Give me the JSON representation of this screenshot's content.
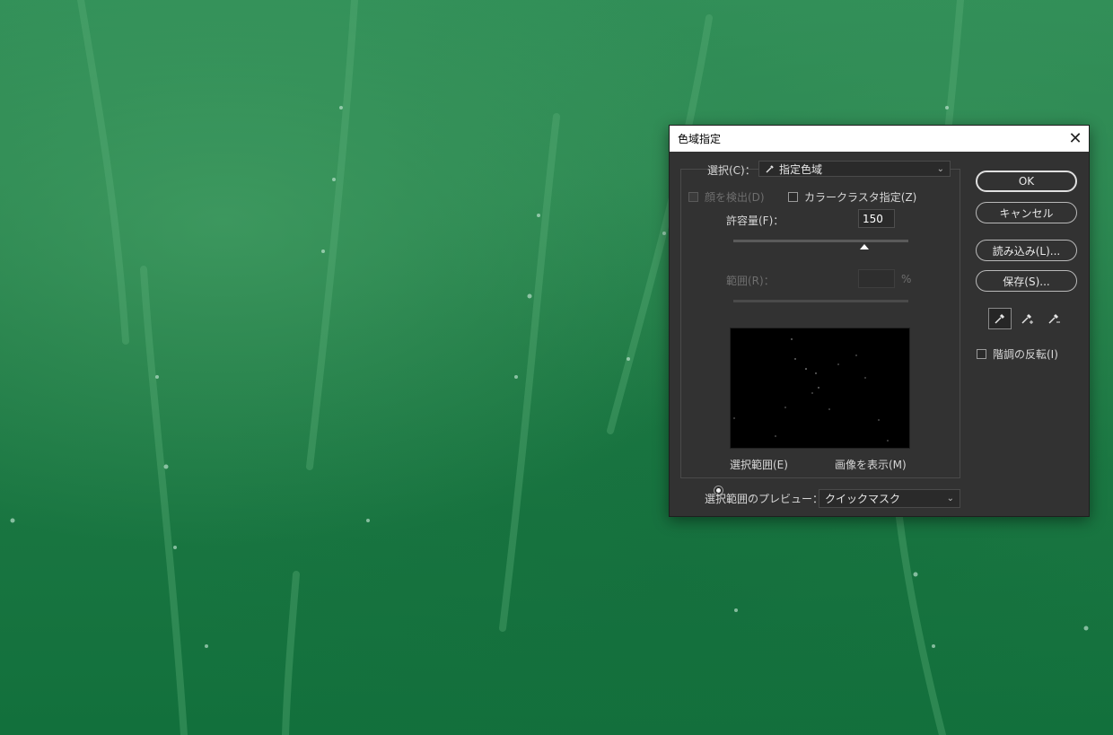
{
  "dialog": {
    "title": "色域指定",
    "select_label": "選択(C)：",
    "select_value": "指定色域",
    "detect_faces_label": "顔を検出(D)",
    "color_cluster_label": "カラークラスタ指定(Z)",
    "fuzziness_label": "許容量(F)：",
    "fuzziness_value": "150",
    "fuzziness_slider": 0.75,
    "range_label": "範囲(R)：",
    "range_value": "",
    "range_unit": "%",
    "radio_selection_label": "選択範囲(E)",
    "radio_image_label": "画像を表示(M)",
    "preview_label": "選択範囲のプレビュー：",
    "preview_value": "クイックマスク",
    "invert_label": "階調の反転(I)"
  },
  "buttons": {
    "ok": "OK",
    "cancel": "キャンセル",
    "load": "読み込み(L)...",
    "save": "保存(S)..."
  },
  "icons": {
    "close": "close-icon",
    "eyedropper": "eyedropper-icon",
    "eyedropper_plus": "eyedropper-plus-icon",
    "eyedropper_minus": "eyedropper-minus-icon",
    "chevron": "chevron-down-icon"
  },
  "colors": {
    "dialog_bg": "#323232",
    "title_bg": "#ffffff",
    "background_green": "#1f7a45"
  }
}
